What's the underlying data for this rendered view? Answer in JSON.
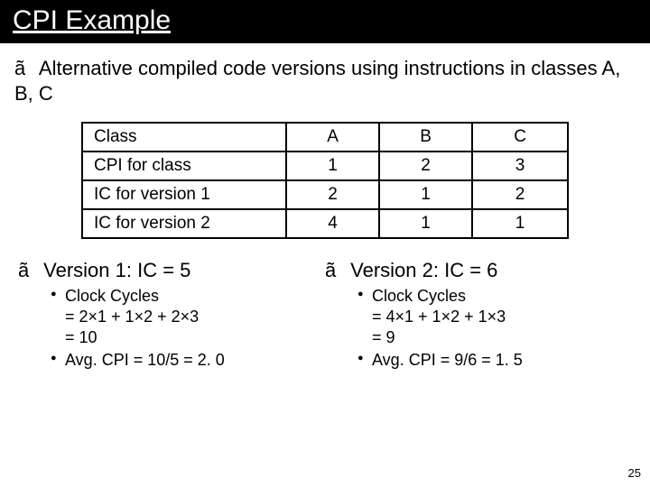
{
  "title": "CPI Example",
  "bullet_glyph": "ã",
  "lead": "Alternative compiled code versions using instructions in classes A, B, C",
  "table": {
    "rows": [
      [
        "Class",
        "A",
        "B",
        "C"
      ],
      [
        "CPI for class",
        "1",
        "2",
        "3"
      ],
      [
        "IC for version 1",
        "2",
        "1",
        "2"
      ],
      [
        "IC for version 2",
        "4",
        "1",
        "1"
      ]
    ]
  },
  "version1": {
    "head": "Version 1: IC = 5",
    "clock_label": "Clock Cycles",
    "clock_l1": "= 2×1 + 1×2 + 2×3",
    "clock_l2": "= 10",
    "avg": "Avg. CPI = 10/5 = 2. 0"
  },
  "version2": {
    "head": "Version 2: IC = 6",
    "clock_label": "Clock Cycles",
    "clock_l1": "= 4×1 + 1×2 + 1×3",
    "clock_l2": "= 9",
    "avg": "Avg. CPI = 9/6 = 1. 5"
  },
  "page_number": "25"
}
